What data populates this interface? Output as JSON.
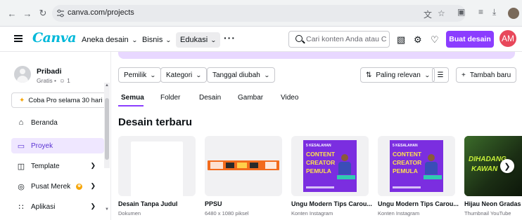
{
  "browser": {
    "url": "canva.com/projects"
  },
  "header": {
    "logo": "Canva",
    "menu": [
      {
        "label": "Aneka desain"
      },
      {
        "label": "Bisnis"
      },
      {
        "label": "Edukasi"
      }
    ],
    "search_placeholder": "Cari konten Anda atau C",
    "create_button": "Buat desain",
    "avatar_initials": "AM"
  },
  "sidebar": {
    "user_name": "Pribadi",
    "user_plan": "Gratis •  ☺ 1",
    "trial_button": "Coba Pro selama 30 hari",
    "items": [
      {
        "label": "Beranda",
        "icon": "home-icon"
      },
      {
        "label": "Proyek",
        "icon": "folder-icon"
      },
      {
        "label": "Template",
        "icon": "template-icon"
      },
      {
        "label": "Pusat Merek",
        "icon": "brand-icon"
      },
      {
        "label": "Aplikasi",
        "icon": "apps-icon"
      }
    ]
  },
  "filters": {
    "owner": "Pemilik",
    "category": "Kategori",
    "date_changed": "Tanggal diubah",
    "sort": "Paling relevan",
    "add_new": "Tambah baru"
  },
  "tabs": [
    {
      "label": "Semua"
    },
    {
      "label": "Folder"
    },
    {
      "label": "Desain"
    },
    {
      "label": "Gambar"
    },
    {
      "label": "Video"
    }
  ],
  "section_title": "Desain terbaru",
  "designs": [
    {
      "title": "Desain Tanpa Judul",
      "subtitle": "Dokumen"
    },
    {
      "title": "PPSU",
      "subtitle": "6480 x 1080 piksel"
    },
    {
      "title": "Ungu Modern Tips Carou...",
      "subtitle": "Konten Instagram",
      "poster": [
        "5 KESALAHAN",
        "CONTENT",
        "CREATOR",
        "PEMULA"
      ]
    },
    {
      "title": "Ungu Modern Tips Carou...",
      "subtitle": "Konten Instagram",
      "poster": [
        "5 KESALAHAN",
        "CONTENT",
        "CREATOR",
        "PEMULA"
      ]
    },
    {
      "title": "Hijau Neon Gradas",
      "subtitle": "Thumbnail YouTube",
      "poster": [
        "DIHADANG",
        "KAWAN"
      ]
    }
  ],
  "colors": {
    "brand_purple": "#8b3dff",
    "logo_cyan": "#00b8d9",
    "avatar_red": "#e8485b"
  }
}
